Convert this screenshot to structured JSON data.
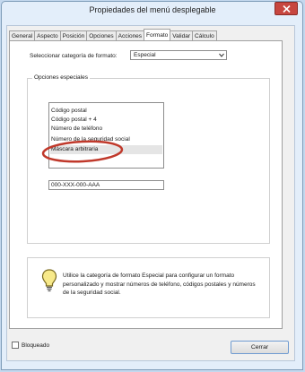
{
  "window": {
    "title": "Propiedades del menú desplegable"
  },
  "tabs": [
    {
      "label": "General"
    },
    {
      "label": "Aspecto"
    },
    {
      "label": "Posición"
    },
    {
      "label": "Opciones"
    },
    {
      "label": "Acciones"
    },
    {
      "label": "Formato",
      "active": true
    },
    {
      "label": "Validar"
    },
    {
      "label": "Cálculo"
    }
  ],
  "format": {
    "category_label": "Seleccionar categoría de formato:",
    "category_value": "Especial"
  },
  "special_options": {
    "group_title": "Opciones especiales",
    "items": [
      {
        "label": "Código postal"
      },
      {
        "label": "Código postal + 4"
      },
      {
        "label": "Número de teléfono"
      },
      {
        "label": "Número de la seguridad social"
      },
      {
        "label": "Máscara arbitraria",
        "selected": true
      }
    ],
    "mask_value": "000-XXX-000-AAA"
  },
  "info": {
    "text": "Utilice la categoría de formato Especial para configurar un formato personalizado y mostrar números de teléfono, códigos postales y números de la seguridad social."
  },
  "footer": {
    "locked_label": "Bloqueado",
    "locked_checked": false,
    "close_label": "Cerrar"
  },
  "colors": {
    "annotation": "#c0392b",
    "accent": "#6f9bd1"
  }
}
